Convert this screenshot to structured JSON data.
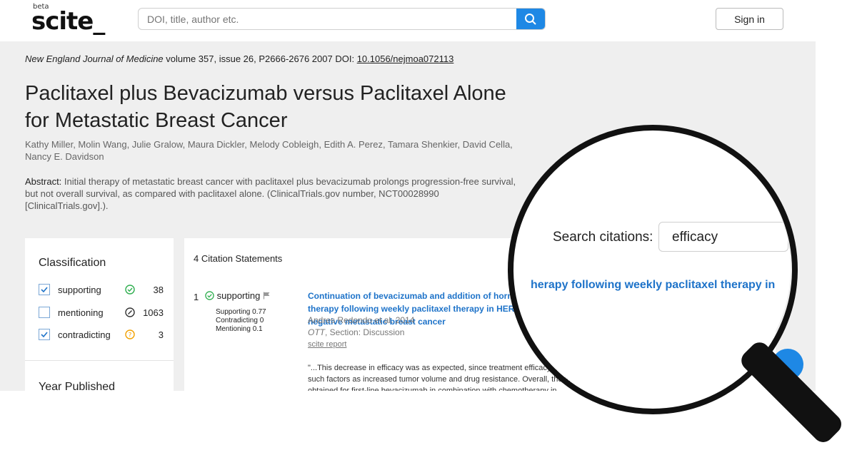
{
  "header": {
    "logo_beta": "beta",
    "logo_text": "scite_",
    "search_placeholder": "DOI, title, author etc.",
    "sign_in_label": "Sign in"
  },
  "paper": {
    "journal": "New England Journal of Medicine",
    "volume_info": " volume 357, issue 26, P2666-2676 2007 DOI: ",
    "doi": "10.1056/nejmoa072113",
    "title": "Paclitaxel plus Bevacizumab versus Paclitaxel Alone for Metastatic Breast Cancer",
    "authors": "Kathy Miller, Molin Wang, Julie Gralow, Maura Dickler, Melody Cobleigh, Edith A. Perez, Tamara Shenkier, David Cella, Nancy E. Davidson",
    "abstract_label": "Abstract:",
    "abstract_text": " Initial therapy of metastatic breast cancer with paclitaxel plus bevacizumab prolongs progression-free survival, but not overall survival, as compared with paclitaxel alone. (ClinicalTrials.gov number, NCT00028990 [ClinicalTrials.gov].)."
  },
  "sidebar": {
    "classification_title": "Classification",
    "items": [
      {
        "label": "supporting",
        "count": "38",
        "checked": true
      },
      {
        "label": "mentioning",
        "count": "1063",
        "checked": false
      },
      {
        "label": "contradicting",
        "count": "3",
        "checked": true
      }
    ],
    "year_title": "Year Published"
  },
  "citations": {
    "count_label": "4 Citation Statements",
    "first": {
      "number": "1",
      "classification": "supporting",
      "stats": [
        "Supporting 0.77",
        "Contradicting 0",
        "Mentioning 0.1"
      ],
      "title": "Continuation of bevacizumab and addition of hormonal therapy following weekly paclitaxel therapy in HER2-negative metastatic breast cancer",
      "authors": "Andres Redondo et al. 2014",
      "journal": "OTT",
      "section": ", Section: Discussion",
      "report_link": "scite report",
      "quote": "\"...This decrease in efficacy was as expected, since treatment efficacy generally declines with progression, due to such factors as increased tumor volume and drug resistance. Overall, these data are comparable with results obtained for first-line bevacizumab in combination with chemotherapy in"
    }
  },
  "magnifier": {
    "search_label": "Search citations:",
    "search_value": "efficacy",
    "highlight_text": "herapy following weekly paclitaxel therapy in"
  },
  "colors": {
    "accent": "#1e88e5",
    "link": "#1e73c9",
    "supporting": "#2fae4f",
    "contradicting": "#f2a100"
  }
}
